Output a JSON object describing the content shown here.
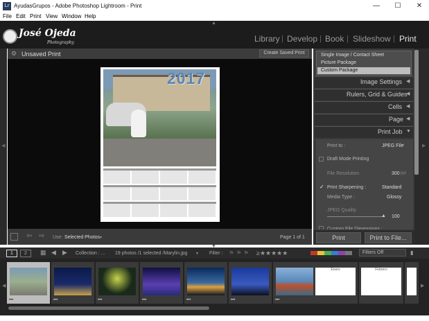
{
  "window": {
    "app_icon": "Lr",
    "title": "AyudasGrupos - Adobe Photoshop Lightroom - Print"
  },
  "menu": [
    "File",
    "Edit",
    "Print",
    "View",
    "Window",
    "Help"
  ],
  "identity": {
    "name": "José Ojeda",
    "tagline": "Photography"
  },
  "modules": [
    "Library",
    "Develop",
    "Book",
    "Slideshow",
    "Print"
  ],
  "center": {
    "header_title": "Unsaved Print",
    "create_saved_print": "Create Saved Print",
    "use_label": "Use:",
    "use_value": "Selected Photos",
    "page_indicator": "Page 1 of 1"
  },
  "calendar": {
    "year": "2017"
  },
  "right_panel": {
    "layout_styles": [
      "Single Image / Contact Sheet",
      "Picture Package",
      "Custom Package"
    ],
    "selected_layout": "Custom Package",
    "sections": [
      "Image Settings",
      "Rulers, Grid & Guides",
      "Cells",
      "Page",
      "Print Job"
    ],
    "print_job": {
      "print_to_label": "Print to :",
      "print_to_value": "JPEG File",
      "draft_mode": "Draft Mode Printing",
      "file_resolution_label": "File Resolution",
      "file_resolution_value": "300",
      "file_resolution_unit": "ppi",
      "print_sharpening_label": "Print Sharpening :",
      "print_sharpening_value": "Standard",
      "media_type_label": "Media Type :",
      "media_type_value": "Glossy",
      "jpeg_quality_label": "JPEG Quality",
      "jpeg_quality_value": "100",
      "custom_dims": "Custom File Dimensions :"
    },
    "print_button": "Print",
    "print_to_file_button": "Print to File..."
  },
  "filmstrip": {
    "page1": "1",
    "page2": "2",
    "collection": "Collection : ...",
    "count": "19 photos /1 selected /Marylin.jpg",
    "filter_label": "Filter :",
    "filters_off": "Filters Off",
    "thumb_dots": "•••",
    "months": [
      "Enero",
      "Febrero"
    ]
  },
  "colors": {
    "panel": "#3b3b3b",
    "selected": "#bdbdbd",
    "accent_red": "#c0392b"
  }
}
